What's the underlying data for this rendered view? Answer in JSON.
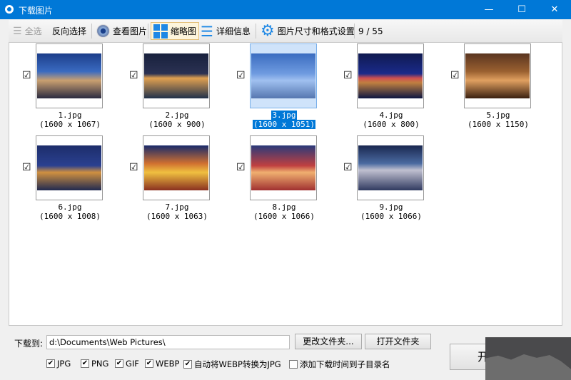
{
  "window": {
    "title": "下载图片",
    "minimize": "—",
    "maximize": "☐",
    "close": "✕"
  },
  "toolbar": {
    "select_all": "全选",
    "invert": "反向选择",
    "view": "查看图片",
    "thumbnails": "缩略图",
    "details": "详细信息",
    "settings": "图片尺寸和格式设置",
    "count": "9 / 55"
  },
  "images": [
    {
      "name": "1.jpg",
      "size": "(1600 x 1067)",
      "checked": true
    },
    {
      "name": "2.jpg",
      "size": "(1600 x 900)",
      "checked": true
    },
    {
      "name": "3.jpg",
      "size": "(1600 x 1051)",
      "checked": true,
      "selected": true
    },
    {
      "name": "4.jpg",
      "size": "(1600 x 800)",
      "checked": true
    },
    {
      "name": "5.jpg",
      "size": "(1600 x 1150)",
      "checked": true
    },
    {
      "name": "6.jpg",
      "size": "(1600 x 1008)",
      "checked": true
    },
    {
      "name": "7.jpg",
      "size": "(1600 x 1063)",
      "checked": true
    },
    {
      "name": "8.jpg",
      "size": "(1600 x 1066)",
      "checked": true
    },
    {
      "name": "9.jpg",
      "size": "(1600 x 1066)",
      "checked": true
    }
  ],
  "bottom": {
    "label": "下载到:",
    "path": "d:\\Documents\\Web Pictures\\",
    "change_folder": "更改文件夹...",
    "open_folder": "打开文件夹",
    "start": "开",
    "options": [
      {
        "label": "JPG",
        "checked": true
      },
      {
        "label": "PNG",
        "checked": true
      },
      {
        "label": "GIF",
        "checked": true
      },
      {
        "label": "WEBP",
        "checked": true
      },
      {
        "label": "自动将WEBP转换为JPG",
        "checked": true
      },
      {
        "label": "添加下载时间到子目录名",
        "checked": false
      }
    ]
  }
}
